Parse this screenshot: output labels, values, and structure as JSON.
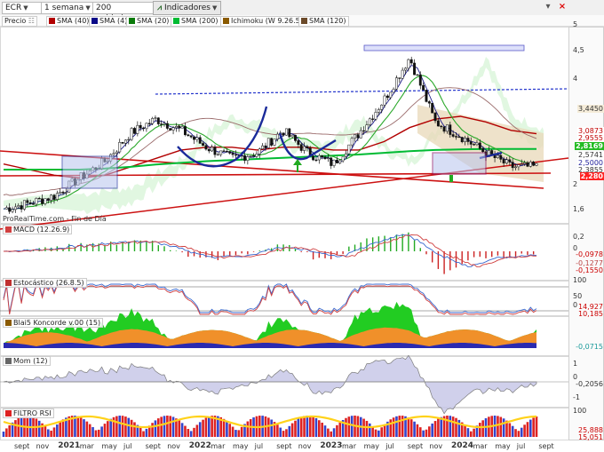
{
  "toolbar": {
    "symbol": "ECR",
    "timeframe": "1 semana",
    "units": "200 unidades",
    "indicators_label": "Indicadores",
    "close_glyph": "×"
  },
  "legend": [
    {
      "label": "Precio",
      "color": "#222222"
    },
    {
      "label": "SMA (40)",
      "color": "#b20000"
    },
    {
      "label": "SMA (4)",
      "color": "#0a0a88"
    },
    {
      "label": "SMA (20)",
      "color": "#0a7a0a"
    },
    {
      "label": "SMA (200)",
      "color": "#00bb33"
    },
    {
      "label": "Ichimoku (W 9.26.52)",
      "color": "#8a5a00"
    },
    {
      "label": "SMA (120)",
      "color": "#6b4a2a"
    }
  ],
  "source_label": "ProRealTime.com - Fin de Día",
  "price_tags": [
    {
      "label": "3,4450",
      "bg": "#f5ecd9",
      "color": "#333333"
    },
    {
      "label": "3,0873",
      "bg": "#ffffff",
      "color": "#c00000"
    },
    {
      "label": "2,9555",
      "bg": "#ffffff",
      "color": "#c00000"
    },
    {
      "label": "2,8169",
      "bg": "#22bb22",
      "color": "#ffffff"
    },
    {
      "label": "2,5741",
      "bg": "#ffffff",
      "color": "#333333"
    },
    {
      "label": "2,5000",
      "bg": "#ffffff",
      "color": "#1e1e9a"
    },
    {
      "label": "2,3855",
      "bg": "#ffffff",
      "color": "#333333"
    },
    {
      "label": "2,280",
      "bg": "#ff2222",
      "color": "#ffffff"
    }
  ],
  "y_ticks": [
    "5",
    "4,5",
    "4",
    "2",
    "1,6"
  ],
  "panels": [
    {
      "name": "MACD (12.26.9)",
      "color": "#d04040",
      "ticks": [
        "0,2",
        "0"
      ],
      "tags": [
        "-0,0978",
        "-0,1277",
        "-0,1550"
      ]
    },
    {
      "name": "Estocástico (26.8.5)",
      "color": "#c03030",
      "ticks": [
        "100",
        "50",
        "0"
      ],
      "tags": [
        "14,927",
        "10,185"
      ]
    },
    {
      "name": "Blai5 Koncorde v.00 (15)",
      "color": "#8a5a00",
      "ticks": [],
      "tags": [
        "-0,0715"
      ]
    },
    {
      "name": "Mom (12)",
      "color": "#666666",
      "ticks": [
        "1",
        "0",
        "-1"
      ],
      "tags": [
        "-0,2056"
      ]
    },
    {
      "name": "FILTRO RSI",
      "color": "#dd2222",
      "ticks": [
        "100"
      ],
      "tags": [
        "25,888",
        "15,051"
      ]
    }
  ],
  "x_axis": [
    "sept",
    "nov",
    "2021",
    "mar",
    "may",
    "jul",
    "sept",
    "nov",
    "2022",
    "mar",
    "may",
    "jul",
    "sept",
    "nov",
    "2023",
    "mar",
    "may",
    "jul",
    "sept",
    "nov",
    "2024",
    "mar",
    "may",
    "jul",
    "sept"
  ],
  "x_year_labels": [
    "2021",
    "2022",
    "2023",
    "2024"
  ],
  "chart_data": {
    "type": "line",
    "title": "ECR",
    "x": [
      "2020-08",
      "2020-10",
      "2020-12",
      "2021-02",
      "2021-04",
      "2021-06",
      "2021-08",
      "2021-10",
      "2021-12",
      "2022-02",
      "2022-04",
      "2022-06",
      "2022-08",
      "2022-10",
      "2022-12",
      "2023-02",
      "2023-04",
      "2023-06",
      "2023-08",
      "2023-10",
      "2023-12",
      "2024-02"
    ],
    "series": [
      {
        "name": "Precio",
        "values": [
          1.75,
          1.85,
          1.98,
          2.3,
          2.6,
          3.1,
          3.35,
          3.15,
          2.85,
          2.65,
          2.75,
          3.15,
          2.75,
          2.55,
          3.1,
          3.7,
          4.45,
          3.3,
          3.05,
          2.75,
          2.5,
          2.5
        ]
      },
      {
        "name": "SMA (40)",
        "values": [
          2.55,
          2.45,
          2.35,
          2.3,
          2.35,
          2.5,
          2.65,
          2.8,
          2.85,
          2.85,
          2.8,
          2.85,
          2.85,
          2.8,
          2.8,
          2.95,
          3.2,
          3.35,
          3.4,
          3.3,
          3.15,
          3.09
        ]
      },
      {
        "name": "SMA (200)",
        "values": [
          2.45,
          2.45,
          2.45,
          2.45,
          2.47,
          2.5,
          2.54,
          2.57,
          2.6,
          2.62,
          2.64,
          2.66,
          2.68,
          2.7,
          2.72,
          2.75,
          2.78,
          2.8,
          2.81,
          2.82,
          2.82,
          2.82
        ]
      }
    ],
    "ylim": [
      1.5,
      5.0
    ],
    "grid": false,
    "last_values": {
      "price": 2.28
    }
  }
}
